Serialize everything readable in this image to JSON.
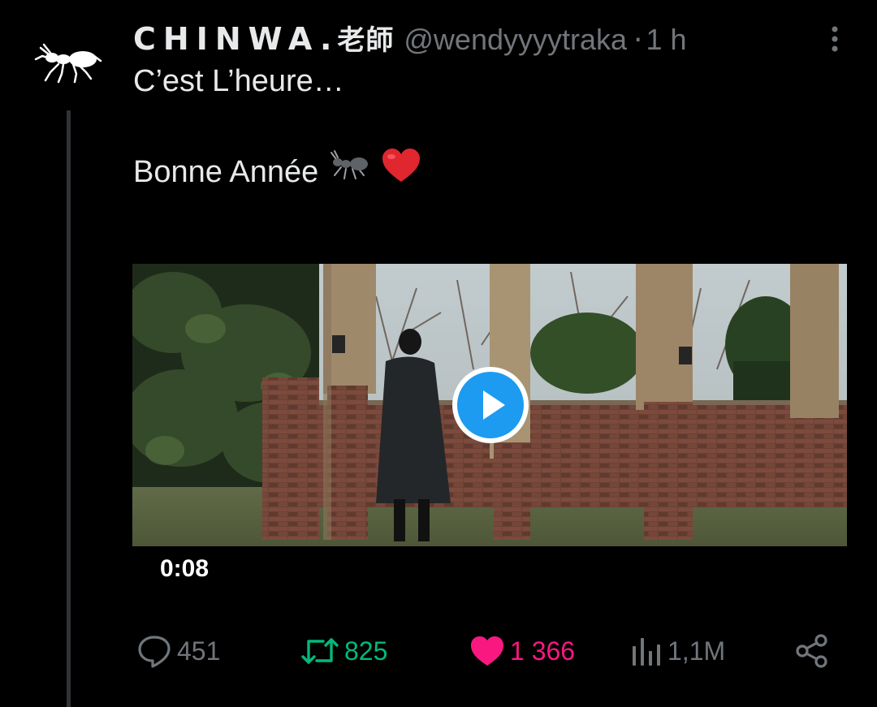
{
  "tweet": {
    "author": {
      "display_name": "CHINWA.",
      "display_name_cjk": "老師",
      "handle": "@wendyyyytraka",
      "avatar_icon": "ant-icon"
    },
    "separator": "·",
    "timestamp": "1 h",
    "text_line1": "C’est L’heure…",
    "text_line2": "Bonne Année",
    "emoji": [
      "ant-emoji-icon",
      "red-heart-emoji-icon"
    ],
    "video": {
      "duration": "0:08",
      "play_icon": "play-icon"
    },
    "actions": {
      "replies": "451",
      "retweets": "825",
      "likes": "1 366",
      "views": "1,1M"
    }
  },
  "colors": {
    "background": "#000000",
    "text": "#e7e9ea",
    "muted": "#71767b",
    "retweet_active": "#00ba7c",
    "like_active": "#f91880",
    "play_button": "#1d9bf0",
    "thread_line": "#2f3336"
  }
}
